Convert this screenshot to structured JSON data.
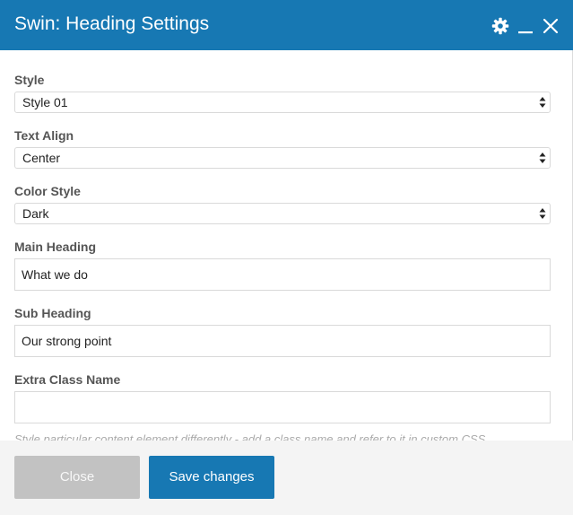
{
  "window": {
    "title": "Swin: Heading Settings",
    "icons": [
      "gear-icon",
      "minimize-icon",
      "close-icon"
    ],
    "accent": "#1778b3"
  },
  "form": {
    "style": {
      "label": "Style",
      "value": "Style 01"
    },
    "text_align": {
      "label": "Text Align",
      "value": "Center"
    },
    "color_style": {
      "label": "Color Style",
      "value": "Dark"
    },
    "main_heading": {
      "label": "Main Heading",
      "value": "What we do"
    },
    "sub_heading": {
      "label": "Sub Heading",
      "value": "Our strong point"
    },
    "extra_class": {
      "label": "Extra Class Name",
      "value": "",
      "hint": "Style particular content element differently - add a class name and refer to it in custom CSS."
    }
  },
  "footer": {
    "close_label": "Close",
    "save_label": "Save changes"
  }
}
